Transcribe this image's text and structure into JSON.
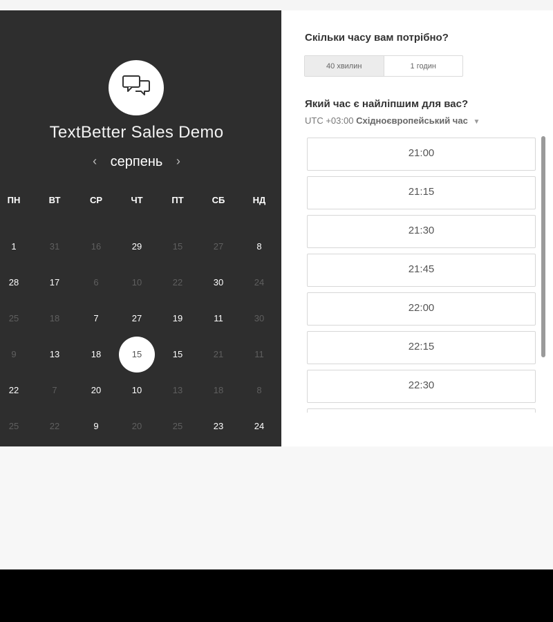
{
  "event": {
    "title": "TextBetter Sales Demo",
    "logo_icon": "chat-bubbles-icon"
  },
  "calendar": {
    "month": "серпень",
    "prev_icon": "‹",
    "next_icon": "›",
    "weekdays": [
      "ПН",
      "ВТ",
      "СР",
      "ЧТ",
      "ПТ",
      "СБ",
      "НД"
    ],
    "weeks": [
      [
        {
          "d": "1",
          "on": true
        },
        {
          "d": "31",
          "on": false
        },
        {
          "d": "16",
          "on": false
        },
        {
          "d": "29",
          "on": true
        },
        {
          "d": "15",
          "on": false
        },
        {
          "d": "27",
          "on": false
        },
        {
          "d": "8",
          "on": true
        }
      ],
      [
        {
          "d": "28",
          "on": true
        },
        {
          "d": "17",
          "on": true
        },
        {
          "d": "6",
          "on": false
        },
        {
          "d": "10",
          "on": false
        },
        {
          "d": "22",
          "on": false
        },
        {
          "d": "30",
          "on": true
        },
        {
          "d": "24",
          "on": false
        }
      ],
      [
        {
          "d": "25",
          "on": false
        },
        {
          "d": "18",
          "on": false
        },
        {
          "d": "7",
          "on": true
        },
        {
          "d": "27",
          "on": true
        },
        {
          "d": "19",
          "on": true
        },
        {
          "d": "11",
          "on": true
        },
        {
          "d": "30",
          "on": false
        }
      ],
      [
        {
          "d": "9",
          "on": false
        },
        {
          "d": "13",
          "on": true
        },
        {
          "d": "18",
          "on": true
        },
        {
          "d": "15",
          "on": true,
          "selected": true
        },
        {
          "d": "15",
          "on": true
        },
        {
          "d": "21",
          "on": false
        },
        {
          "d": "11",
          "on": false
        }
      ],
      [
        {
          "d": "22",
          "on": true
        },
        {
          "d": "7",
          "on": false
        },
        {
          "d": "20",
          "on": true
        },
        {
          "d": "10",
          "on": true
        },
        {
          "d": "13",
          "on": false
        },
        {
          "d": "18",
          "on": false
        },
        {
          "d": "8",
          "on": false
        }
      ],
      [
        {
          "d": "25",
          "on": false
        },
        {
          "d": "22",
          "on": false
        },
        {
          "d": "9",
          "on": true
        },
        {
          "d": "20",
          "on": false
        },
        {
          "d": "25",
          "on": false
        },
        {
          "d": "23",
          "on": true
        },
        {
          "d": "24",
          "on": true
        }
      ]
    ]
  },
  "duration": {
    "question": "Скільки часу вам потрібно?",
    "options": [
      {
        "label": "40 хвилин",
        "active": true
      },
      {
        "label": "1 годин",
        "active": false
      }
    ]
  },
  "time": {
    "question": "Який час є найліпшим для вас?",
    "timezone_offset": "UTC +03:00",
    "timezone_name": "Східноєвропейський час",
    "slots": [
      "21:00",
      "21:15",
      "21:30",
      "21:45",
      "22:00",
      "22:15",
      "22:30",
      ""
    ]
  },
  "colors": {
    "left_panel": "#2e2e2e",
    "right_panel": "#ffffff",
    "bottom_bar": "#000000"
  }
}
